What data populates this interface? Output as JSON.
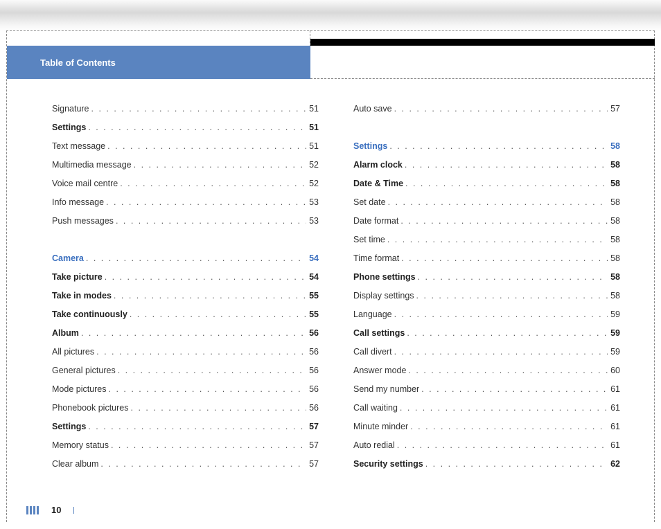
{
  "header": {
    "title": "Table of Contents"
  },
  "footer": {
    "page": "10"
  },
  "left": [
    {
      "label": "Signature",
      "page": "51",
      "style": ""
    },
    {
      "label": "Settings",
      "page": "51",
      "style": "bold"
    },
    {
      "label": "Text message",
      "page": "51",
      "style": ""
    },
    {
      "label": "Multimedia message",
      "page": "52",
      "style": ""
    },
    {
      "label": "Voice mail centre",
      "page": "52",
      "style": ""
    },
    {
      "label": "Info message",
      "page": "53",
      "style": ""
    },
    {
      "label": "Push messages",
      "page": "53",
      "style": ""
    },
    {
      "gap": true
    },
    {
      "label": "Camera",
      "page": "54",
      "style": "section"
    },
    {
      "label": "Take picture",
      "page": "54",
      "style": "bold"
    },
    {
      "label": "Take in modes",
      "page": "55",
      "style": "bold"
    },
    {
      "label": "Take continuously",
      "page": "55",
      "style": "bold"
    },
    {
      "label": "Album",
      "page": "56",
      "style": "bold"
    },
    {
      "label": "All pictures",
      "page": "56",
      "style": ""
    },
    {
      "label": "General pictures",
      "page": "56",
      "style": ""
    },
    {
      "label": "Mode pictures",
      "page": "56",
      "style": ""
    },
    {
      "label": "Phonebook pictures",
      "page": "56",
      "style": ""
    },
    {
      "label": "Settings",
      "page": "57",
      "style": "bold"
    },
    {
      "label": "Memory status",
      "page": "57",
      "style": ""
    },
    {
      "label": "Clear album",
      "page": "57",
      "style": ""
    }
  ],
  "right": [
    {
      "label": "Auto save",
      "page": "57",
      "style": ""
    },
    {
      "gap": true
    },
    {
      "label": "Settings",
      "page": "58",
      "style": "section"
    },
    {
      "label": "Alarm clock",
      "page": "58",
      "style": "bold"
    },
    {
      "label": "Date & Time",
      "page": "58",
      "style": "bold"
    },
    {
      "label": "Set date",
      "page": "58",
      "style": ""
    },
    {
      "label": "Date format",
      "page": "58",
      "style": ""
    },
    {
      "label": "Set time",
      "page": "58",
      "style": ""
    },
    {
      "label": "Time format",
      "page": "58",
      "style": ""
    },
    {
      "label": "Phone settings",
      "page": "58",
      "style": "bold"
    },
    {
      "label": "Display settings",
      "page": "58",
      "style": ""
    },
    {
      "label": "Language",
      "page": "59",
      "style": ""
    },
    {
      "label": "Call settings",
      "page": "59",
      "style": "bold"
    },
    {
      "label": "Call divert",
      "page": "59",
      "style": ""
    },
    {
      "label": "Answer mode",
      "page": "60",
      "style": ""
    },
    {
      "label": "Send my number",
      "page": "61",
      "style": ""
    },
    {
      "label": "Call waiting",
      "page": "61",
      "style": ""
    },
    {
      "label": "Minute minder",
      "page": "61",
      "style": ""
    },
    {
      "label": "Auto redial",
      "page": "61",
      "style": ""
    },
    {
      "label": "Security settings",
      "page": "62",
      "style": "bold"
    }
  ]
}
